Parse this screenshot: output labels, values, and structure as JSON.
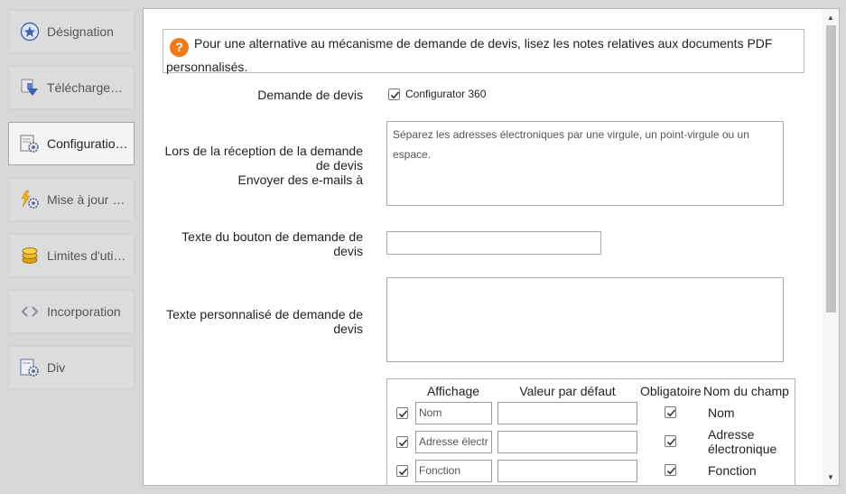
{
  "sidebar": {
    "items": [
      {
        "label": "Désignation",
        "icon": "star-badge-icon"
      },
      {
        "label": "Télécharge…",
        "icon": "download-icon"
      },
      {
        "label": "Configuratio…",
        "icon": "configuration-gear-icon",
        "active": true
      },
      {
        "label": "Mise à jour …",
        "icon": "update-lightning-gear-icon"
      },
      {
        "label": "Limites d'uti…",
        "icon": "coins-icon"
      },
      {
        "label": "Incorporation",
        "icon": "embed-code-icon"
      },
      {
        "label": "Div",
        "icon": "misc-gear-icon"
      }
    ]
  },
  "info": {
    "text": "Pour une alternative au mécanisme de demande de devis, lisez les notes relatives aux documents PDF personnalisés."
  },
  "form": {
    "quote_request_label": "Demande de devis",
    "configurator_checkbox_label": "Configurator 360",
    "configurator_checked": true,
    "emails_label_line1": "Lors de la réception de la demande",
    "emails_label_line2": "de devis",
    "emails_label_line3": "Envoyer des e-mails à",
    "emails_placeholder": "Séparez les adresses électroniques par une virgule, un point-virgule ou un espace.",
    "button_text_label_line1": "Texte du bouton de demande de",
    "button_text_label_line2": "devis",
    "button_text_value": "",
    "custom_text_label_line1": "Texte personnalisé de demande de",
    "custom_text_label_line2": "devis",
    "custom_text_value": ""
  },
  "fields_table": {
    "headers": {
      "display": "Affichage",
      "default_value": "Valeur par défaut",
      "required": "Obligatoire",
      "field_name": "Nom du champ"
    },
    "rows": [
      {
        "display_checked": true,
        "display_value": "Nom",
        "default_value": "",
        "required_checked": true,
        "field_name": "Nom"
      },
      {
        "display_checked": true,
        "display_value": "Adresse électr",
        "default_value": "",
        "required_checked": true,
        "field_name_line1": "Adresse",
        "field_name_line2": "électronique"
      },
      {
        "display_checked": true,
        "display_value": "Fonction",
        "default_value": "",
        "required_checked": true,
        "field_name": "Fonction"
      }
    ]
  },
  "colors": {
    "info_icon": "#ef7a1a",
    "sidebar_bg": "#d7d7d7",
    "active_item_bg": "#f4f4f4"
  }
}
